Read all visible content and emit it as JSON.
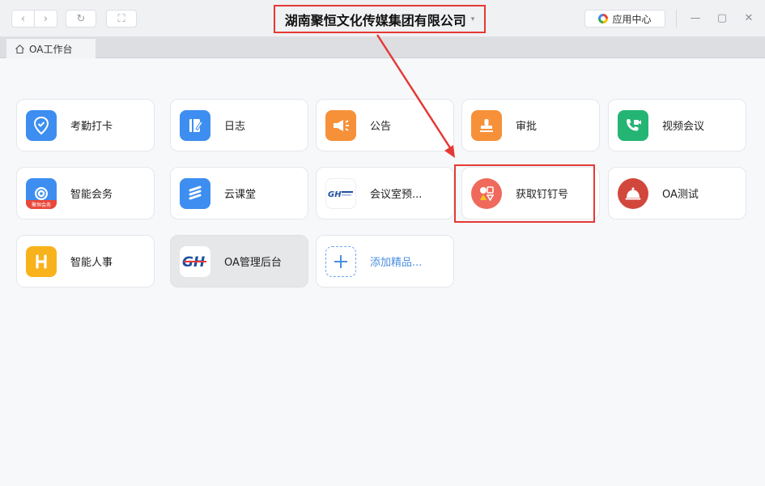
{
  "titlebar": {
    "back_glyph": "‹",
    "forward_glyph": "›",
    "refresh_glyph": "↻",
    "fullscreen_glyph": "⛶",
    "company_name": "湖南聚恒文化传媒集团有限公司",
    "company_caret": "▾",
    "app_center_label": "应用中心",
    "minimize_glyph": "—",
    "maximize_glyph": "▢",
    "close_glyph": "✕"
  },
  "tabs": [
    {
      "label": "OA工作台",
      "icon": "home-icon"
    }
  ],
  "apps": [
    {
      "label": "考勤打卡",
      "icon": "location-check-icon",
      "color": "#3d8ef0"
    },
    {
      "label": "日志",
      "icon": "journal-edit-icon",
      "color": "#3d8ef0"
    },
    {
      "label": "公告",
      "icon": "megaphone-icon",
      "color": "#f6913a"
    },
    {
      "label": "审批",
      "icon": "stamp-icon",
      "color": "#f6913a"
    },
    {
      "label": "视频会议",
      "icon": "video-call-icon",
      "color": "#24b574"
    },
    {
      "label": "智能会务",
      "icon": "meeting-service-icon",
      "color": "#3d8ef0",
      "badge_text": "聚恒会务"
    },
    {
      "label": "云课堂",
      "icon": "cloud-classroom-icon",
      "color": "#3d8ef0"
    },
    {
      "label": "会议室预...",
      "icon": "juheng-logo-icon",
      "color": "#ffffff"
    },
    {
      "label": "获取钉钉号",
      "icon": "shapes-icon",
      "color": "#ef6a5c"
    },
    {
      "label": "OA测试",
      "icon": "service-bell-icon",
      "color": "#d2473c"
    },
    {
      "label": "智能人事",
      "icon": "hr-icon",
      "color": "#f8b21c"
    },
    {
      "label": "OA管理后台",
      "icon": "gh-logo-icon",
      "color": "#ffffff"
    },
    {
      "label": "添加精品...",
      "icon": "add-icon",
      "color": "#4a8fe0"
    }
  ]
}
